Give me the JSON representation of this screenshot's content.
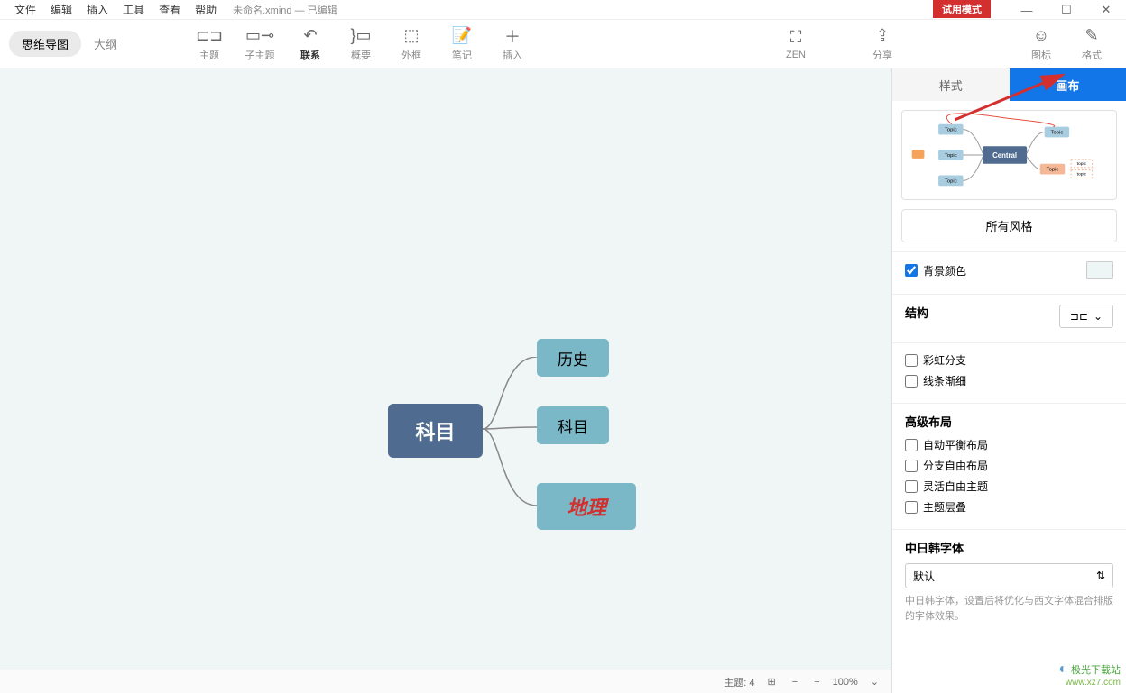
{
  "menubar": {
    "items": [
      "文件",
      "编辑",
      "插入",
      "工具",
      "查看",
      "帮助"
    ],
    "filename": "未命名.xmind",
    "status": "— 已编辑"
  },
  "trial": "试用模式",
  "view_tabs": {
    "mindmap": "思维导图",
    "outline": "大纲"
  },
  "tools": {
    "theme": "主题",
    "subtopic": "子主题",
    "relation": "联系",
    "summary": "概要",
    "boundary": "外框",
    "note": "笔记",
    "insert": "插入",
    "zen": "ZEN",
    "share": "分享",
    "icons": "图标",
    "format": "格式"
  },
  "mindmap": {
    "central": "科目",
    "children": [
      "历史",
      "科目",
      "地理"
    ]
  },
  "sidepanel": {
    "tabs": {
      "style": "样式",
      "canvas": "画布"
    },
    "all_styles": "所有风格",
    "bg_section": {
      "label": "背景颜色"
    },
    "struct_section": {
      "title": "结构"
    },
    "rainbow": "彩虹分支",
    "taper": "线条渐细",
    "adv_layout": {
      "title": "高级布局",
      "auto_balance": "自动平衡布局",
      "free_branch": "分支自由布局",
      "free_topic": "灵活自由主题",
      "overlap": "主题层叠"
    },
    "cjk_font": {
      "title": "中日韩字体",
      "default": "默认",
      "hint": "中日韩字体，设置后将优化与西文字体混合排版的字体效果。"
    },
    "preview": {
      "central": "Central",
      "topic": "Topic",
      "topic2": "topic"
    }
  },
  "statusbar": {
    "topics_label": "主题:",
    "topics_count": "4",
    "zoom": "100%"
  },
  "watermark": {
    "name": "极光下载站",
    "url": "www.xz7.com"
  }
}
